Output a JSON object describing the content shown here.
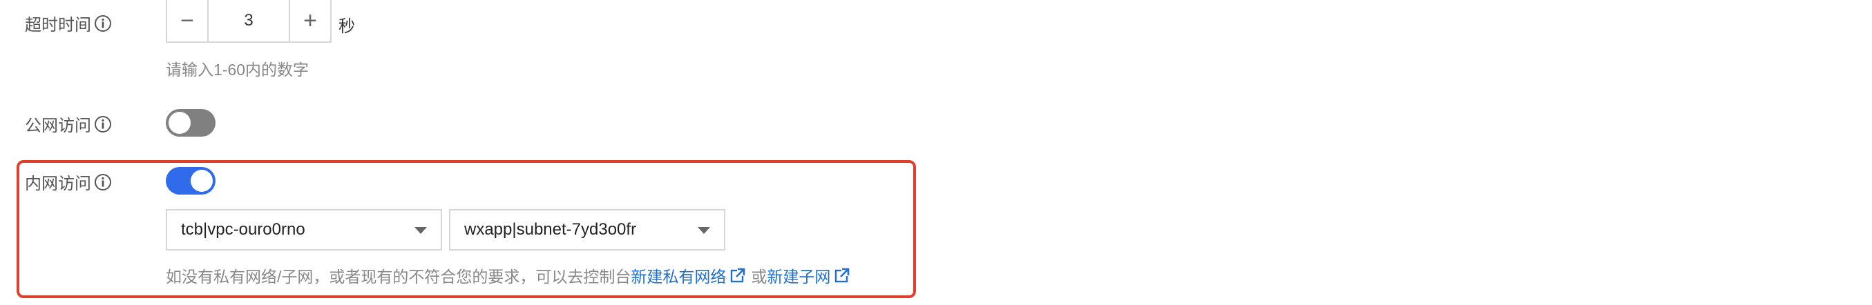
{
  "timeout": {
    "label": "超时时间",
    "minus_symbol": "−",
    "value": "3",
    "plus_symbol": "+",
    "unit": "秒",
    "hint": "请输入1-60内的数字"
  },
  "public_access": {
    "label": "公网访问",
    "enabled": false
  },
  "private_access": {
    "label": "内网访问",
    "enabled": true,
    "vpc_select": "tcb|vpc-ouro0rno",
    "subnet_select": "wxapp|subnet-7yd3o0fr",
    "hint_text": "如没有私有网络/子网，或者现有的不符合您的要求，可以去控制台",
    "link_new_vpc": "新建私有网络",
    "hint_or": "或",
    "link_new_subnet": "新建子网"
  },
  "colors": {
    "accent": "#2f6bea",
    "link": "#1f6ed4",
    "highlight_border": "#e0402b",
    "toggle_off": "#808080"
  },
  "icons": {
    "info": "info-circle-icon",
    "external": "external-link-icon",
    "caret": "caret-down-icon"
  }
}
